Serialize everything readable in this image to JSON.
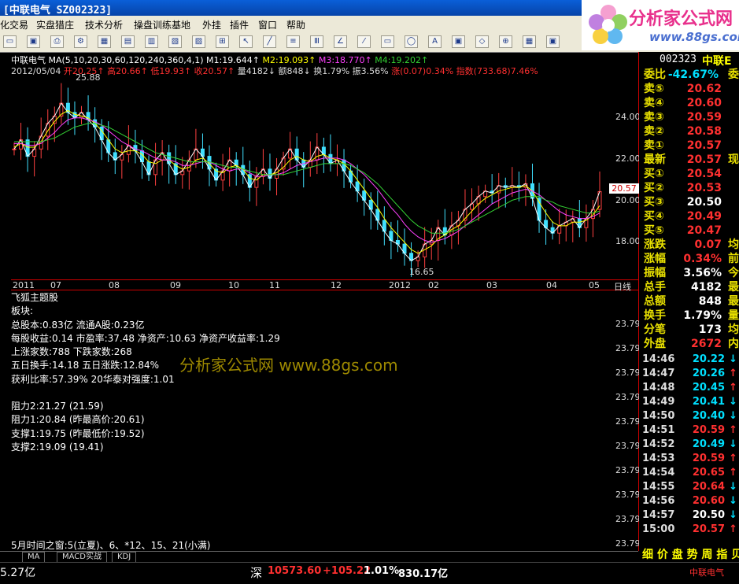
{
  "window": {
    "title": "[中联电气 SZ002323]"
  },
  "menu": [
    "化交易",
    "实盘猎庄",
    "技术分析",
    "操盘训练基地",
    "外挂",
    "插件",
    "窗口",
    "帮助"
  ],
  "logo": {
    "text": "分析家公式网",
    "url": "www.88gs.com"
  },
  "stock": {
    "name": "中联电气",
    "ma_label": "MA(5,10,20,30,60,120,240,360,4,1)",
    "m1": "M1:19.644↑",
    "m2": "M2:19.093↑",
    "m3": "M3:18.770↑",
    "m4": "M4:19.202↑",
    "date": "2012/05/04",
    "open": "开20.25↑",
    "high": "高20.66↑",
    "low": "低19.93↑",
    "close": "收20.57↑",
    "vol": "量4182↓",
    "amount": "额848↓",
    "turnover": "换1.79%",
    "amp": "振3.56%",
    "chg": "涨(0.07)0.34%",
    "index": "指数(733.68)7.46%"
  },
  "chart_data": {
    "type": "line",
    "title": "",
    "price_ticks": [
      "24.00",
      "22.00",
      "20.00",
      "18.00"
    ],
    "date_ticks": [
      "2011",
      "07",
      "08",
      "09",
      "10",
      "11",
      "12",
      "2012",
      "02",
      "03",
      "04",
      "05",
      "日线"
    ],
    "high_label": "25.88",
    "low_label": "16.65",
    "last_price_tag": "20.57",
    "ylim": [
      15.9,
      27.0
    ],
    "series": [
      {
        "values": [
          22.9,
          23.4,
          22.5,
          22.9,
          23.6,
          24.3,
          24.7,
          25.4,
          24.9,
          24.6,
          24.9,
          24.5,
          24.1,
          23.4,
          22.7,
          22.3,
          22.6,
          23.1,
          22.8,
          22.2,
          21.5,
          22.3,
          22.7,
          22.1,
          21.5,
          21.7,
          22.3,
          22.9,
          22.5,
          21.8,
          21.2,
          21.7,
          22.3,
          22.0,
          21.5,
          20.8,
          21.4,
          21.8,
          21.3,
          21.8,
          22.4,
          22.9,
          22.3,
          21.9,
          22.3,
          23.0,
          22.6,
          22.1,
          22.3,
          21.7,
          21.1,
          20.6,
          20.1,
          19.6,
          19.0,
          18.4,
          17.9,
          17.7,
          17.2,
          16.8,
          17.0,
          17.7,
          17.9,
          18.6,
          18.2,
          18.7,
          19.0,
          19.6,
          19.9,
          20.3,
          20.6,
          20.5,
          20.9,
          20.8,
          20.9,
          20.8,
          21.0,
          20.2,
          19.0,
          18.6,
          18.3,
          18.7,
          18.9,
          19.1,
          18.6,
          19.1,
          19.6,
          20.57
        ]
      },
      {
        "values": [
          23.0,
          23.2,
          23.0,
          23.0,
          23.3,
          23.9,
          24.4,
          24.8,
          25.0,
          24.8,
          24.7,
          24.6,
          24.3,
          23.9,
          23.4,
          22.9,
          22.7,
          22.8,
          22.8,
          22.6,
          22.2,
          22.1,
          22.3,
          22.3,
          22.0,
          21.8,
          21.9,
          22.3,
          22.4,
          22.1,
          21.7,
          21.6,
          21.9,
          22.0,
          21.8,
          21.3,
          21.2,
          21.5,
          21.5,
          21.6,
          21.9,
          22.3,
          22.5,
          22.3,
          22.2,
          22.5,
          22.6,
          22.4,
          22.3,
          22.1,
          21.7,
          21.2,
          20.7,
          20.2,
          19.7,
          19.1,
          18.6,
          18.2,
          17.8,
          17.4,
          17.2,
          17.4,
          17.6,
          18.0,
          18.2,
          18.5,
          18.7,
          19.1,
          19.5,
          19.9,
          20.2,
          20.4,
          20.6,
          20.7,
          20.8,
          20.8,
          20.9,
          20.6,
          20.0,
          19.4,
          18.9,
          18.7,
          18.7,
          18.9,
          18.9,
          19.0,
          19.3,
          19.8
        ]
      },
      {
        "values": [
          23.2,
          23.2,
          23.1,
          23.1,
          23.2,
          23.5,
          23.8,
          24.2,
          24.5,
          24.6,
          24.6,
          24.5,
          24.4,
          24.2,
          23.9,
          23.6,
          23.3,
          23.1,
          22.9,
          22.8,
          22.6,
          22.4,
          22.3,
          22.3,
          22.2,
          22.0,
          22.0,
          22.1,
          22.2,
          22.2,
          22.0,
          21.8,
          21.7,
          21.8,
          21.8,
          21.6,
          21.4,
          21.4,
          21.5,
          21.5,
          21.6,
          21.8,
          22.0,
          22.1,
          22.2,
          22.3,
          22.4,
          22.4,
          22.4,
          22.3,
          22.1,
          21.8,
          21.5,
          21.1,
          20.7,
          20.2,
          19.7,
          19.3,
          18.8,
          18.4,
          18.1,
          17.9,
          17.8,
          17.9,
          18.0,
          18.2,
          18.4,
          18.7,
          19.0,
          19.3,
          19.6,
          19.9,
          20.1,
          20.3,
          20.5,
          20.6,
          20.7,
          20.6,
          20.4,
          20.1,
          19.8,
          19.5,
          19.3,
          19.2,
          19.1,
          19.1,
          19.2,
          19.4
        ]
      },
      {
        "values": [
          23.3,
          23.3,
          23.3,
          23.3,
          23.3,
          23.4,
          23.5,
          23.7,
          23.9,
          24.1,
          24.2,
          24.3,
          24.3,
          24.2,
          24.1,
          23.9,
          23.7,
          23.5,
          23.3,
          23.1,
          22.9,
          22.7,
          22.6,
          22.5,
          22.4,
          22.3,
          22.2,
          22.2,
          22.2,
          22.2,
          22.1,
          22.0,
          21.9,
          21.9,
          21.8,
          21.7,
          21.6,
          21.5,
          21.5,
          21.5,
          21.5,
          21.6,
          21.7,
          21.8,
          21.9,
          22.0,
          22.1,
          22.1,
          22.1,
          22.1,
          22.0,
          21.8,
          21.6,
          21.3,
          21.0,
          20.6,
          20.2,
          19.8,
          19.4,
          19.0,
          18.7,
          18.5,
          18.3,
          18.3,
          18.3,
          18.4,
          18.5,
          18.7,
          18.9,
          19.1,
          19.3,
          19.5,
          19.7,
          19.9,
          20.1,
          20.2,
          20.3,
          20.3,
          20.3,
          20.1,
          20.0,
          19.8,
          19.7,
          19.6,
          19.5,
          19.4,
          19.4,
          19.5
        ]
      }
    ],
    "series_colors": [
      "#ffffff",
      "#ffff00",
      "#ff40ff",
      "#33d033"
    ]
  },
  "info": {
    "title": "飞狐主题股",
    "sector": "板块:",
    "l1": "总股本:0.83亿 流通A股:0.23亿",
    "l2": "每股收益:0.14 市盈率:37.48 净资产:10.63 净资产收益率:1.29",
    "l3": "上涨家数:788 下跌家数:268",
    "l4": "五日换手:14.18 五日涨跌:12.84%",
    "l5": "获利比率:57.39% 20华泰对强度:1.01",
    "r1": "阻力2:21.27 (21.59)",
    "r2": "阻力1:20.84 (昨最高价:20.61)",
    "s1": "支撑1:19.75 (昨最低价:19.52)",
    "s2": "支撑2:19.09 (19.41)",
    "window_note": "5月时间之窗:5(立夏)、6、*12、15、21(小满)",
    "watermark": "分析家公式网 www.88gs.com",
    "y_label": "23.79"
  },
  "tabs": [
    "MA",
    "MACD实战",
    "KDJ"
  ],
  "status": {
    "left": "5.27亿",
    "market": "深",
    "index": "10573.60",
    "change": "+105.22",
    "pct": "1.01%",
    "amount": "830.17亿",
    "right": "中联电气"
  },
  "quote": {
    "code": "002323",
    "name": "中联E",
    "weibi_label": "委比",
    "weibi": "-42.67%",
    "weibi_x": "委",
    "sells": [
      {
        "l": "卖⑤",
        "v": "20.62"
      },
      {
        "l": "卖④",
        "v": "20.60"
      },
      {
        "l": "卖③",
        "v": "20.59"
      },
      {
        "l": "卖②",
        "v": "20.58"
      },
      {
        "l": "卖①",
        "v": "20.57"
      }
    ],
    "last_label": "最新",
    "last": "20.57",
    "last_x": "现",
    "buys": [
      {
        "l": "买①",
        "v": "20.54"
      },
      {
        "l": "买②",
        "v": "20.53"
      },
      {
        "l": "买③",
        "v": "20.50"
      },
      {
        "l": "买④",
        "v": "20.49"
      },
      {
        "l": "买⑤",
        "v": "20.47"
      }
    ],
    "stats": [
      {
        "l": "涨跌",
        "v": "0.07",
        "x": "均"
      },
      {
        "l": "涨幅",
        "v": "0.34%",
        "x": "前"
      },
      {
        "l": "振幅",
        "v": "3.56%",
        "x": "今"
      },
      {
        "l": "总手",
        "v": "4182",
        "x": "最"
      },
      {
        "l": "总额",
        "v": "848",
        "x": "最"
      },
      {
        "l": "换手",
        "v": "1.79%",
        "x": "量"
      },
      {
        "l": "分笔",
        "v": "173",
        "x": "均"
      }
    ],
    "waipan_label": "外盘",
    "waipan": "2672",
    "waipan_x": "内",
    "ticks": [
      {
        "t": "14:46",
        "p": "20.22",
        "a": "↓",
        "c": "#00e0ff"
      },
      {
        "t": "14:47",
        "p": "20.26",
        "a": "↑",
        "c": "#00e0ff"
      },
      {
        "t": "14:48",
        "p": "20.45",
        "a": "↑",
        "c": "#00e0ff"
      },
      {
        "t": "14:49",
        "p": "20.41",
        "a": "↓",
        "c": "#00e0ff"
      },
      {
        "t": "14:50",
        "p": "20.40",
        "a": "↓",
        "c": "#00e0ff"
      },
      {
        "t": "14:51",
        "p": "20.59",
        "a": "↑",
        "c": "#ff3030"
      },
      {
        "t": "14:52",
        "p": "20.49",
        "a": "↓",
        "c": "#00e0ff"
      },
      {
        "t": "14:53",
        "p": "20.59",
        "a": "↑",
        "c": "#ff3030"
      },
      {
        "t": "14:54",
        "p": "20.65",
        "a": "↑",
        "c": "#ff3030"
      },
      {
        "t": "14:55",
        "p": "20.64",
        "a": "↓",
        "c": "#ff3030"
      },
      {
        "t": "14:56",
        "p": "20.60",
        "a": "↓",
        "c": "#ff3030"
      },
      {
        "t": "14:57",
        "p": "20.50",
        "a": "↓",
        "c": "#ffffff"
      },
      {
        "t": "15:00",
        "p": "20.57",
        "a": "↑",
        "c": "#ff3030"
      }
    ],
    "bottom": "细 价 盘 势 周 指 贝"
  }
}
